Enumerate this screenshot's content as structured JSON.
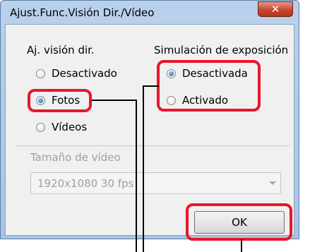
{
  "window": {
    "title": "Ajust.Func.Visión Dir./Vídeo",
    "close_symbol": "✕"
  },
  "live_view": {
    "group_label": "Aj. visión dir.",
    "options": [
      {
        "label": "Desactivado",
        "selected": false
      },
      {
        "label": "Fotos",
        "selected": true
      },
      {
        "label": "Vídeos",
        "selected": false
      }
    ]
  },
  "exposure_sim": {
    "group_label": "Simulación de exposición",
    "options": [
      {
        "label": "Desactivada",
        "selected": true
      },
      {
        "label": "Activado",
        "selected": false
      }
    ]
  },
  "movie_size": {
    "label": "Tamaño de vídeo",
    "value": "1920x1080  30 fps",
    "enabled": false
  },
  "buttons": {
    "ok_label": "OK"
  },
  "annotations": {
    "highlight_color": "#e8162b",
    "icons": [
      "close-icon",
      "dropdown-arrow-icon",
      "radio-icon"
    ]
  }
}
